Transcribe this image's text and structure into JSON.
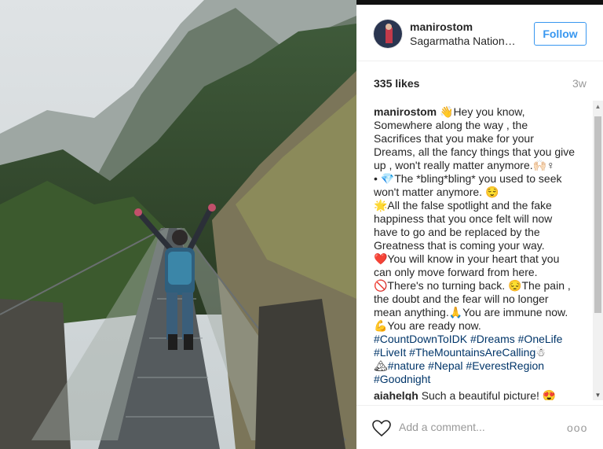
{
  "post": {
    "username": "manirostom",
    "location": "Sagarmatha Nationa...",
    "follow_label": "Follow",
    "likes": "335 likes",
    "age": "3w"
  },
  "caption": {
    "user": "manirostom",
    "lines": [
      "👋Hey you know,",
      "Somewhere along the way , the",
      "Sacrifices that you make for your",
      "Dreams, all the fancy things that you give",
      "up , won't really matter anymore.🙌🏻♀",
      "• 💎The *bling*bling* you used to seek",
      "won't matter anymore. 😌",
      "🌟All the false spotlight and the fake",
      "happiness that you once felt will now",
      "have to go and be replaced by the",
      "Greatness that is coming your way.",
      "❤️You will know in your heart that you",
      "can only move forward from here.",
      "🚫There's no turning back. 😔The pain ,",
      "the doubt and the fear will no longer",
      "mean anything.🙏You are immune now.",
      "💪You are ready now."
    ],
    "tags_line1": [
      "#CountDownToIDK",
      "#Dreams",
      "#OneLife"
    ],
    "tags_line2": [
      "#LiveIt",
      "#TheMountainsAreCalling"
    ],
    "tags_line2_suffix": "☃",
    "tags_line3_prefix": "🏔",
    "tags_line3": [
      "#nature",
      "#Nepal",
      "#EverestRegion"
    ],
    "tags_line4": [
      "#Goodnight"
    ]
  },
  "comment2": {
    "user": "aiahelgh",
    "text": "Such a beautiful picture! 😍"
  },
  "footer": {
    "add_comment_placeholder": "Add a comment...",
    "more_label": "ooo"
  },
  "icons": {
    "like": "heart-icon",
    "more": "more-options-icon"
  },
  "colors": {
    "accent": "#3897f0",
    "hashtag": "#003569",
    "muted": "#999999"
  }
}
